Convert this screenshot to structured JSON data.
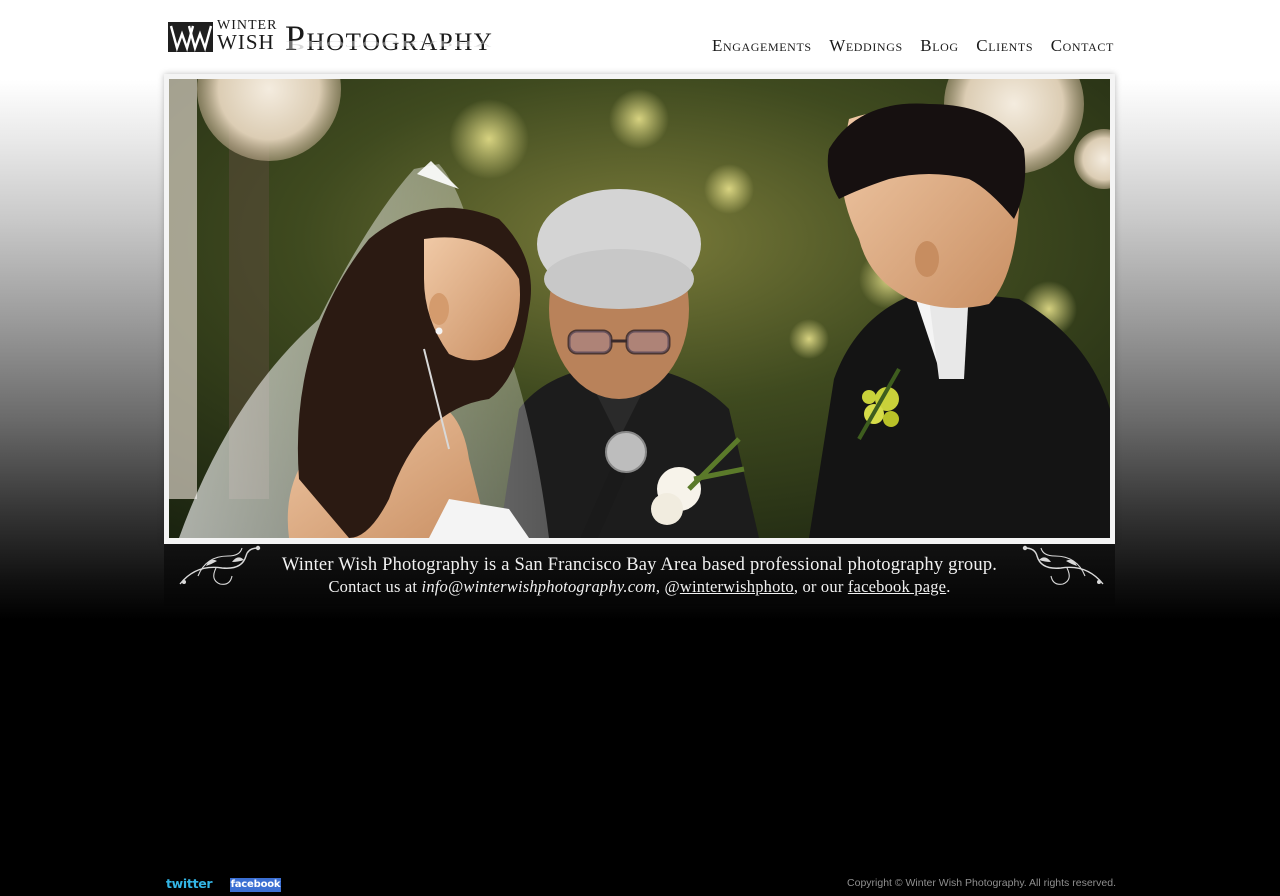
{
  "header": {
    "logo": {
      "mark": "WW",
      "winter": "WINTER",
      "wish": "WISH",
      "photography": "Photography"
    },
    "nav": [
      {
        "label": "Engagements"
      },
      {
        "label": "Weddings"
      },
      {
        "label": "Blog"
      },
      {
        "label": "Clients"
      },
      {
        "label": "Contact"
      }
    ]
  },
  "hero": {
    "caption_line1": "Winter Wish Photography is a San Francisco Bay Area based professional photography group.",
    "contact_prefix": "Contact us at ",
    "email": "info@winterwishphotography.com",
    "separator1": ", @",
    "twitter_handle": "winterwishphoto",
    "separator2": ", or our ",
    "facebook_text": "facebook page",
    "suffix": "."
  },
  "footer": {
    "twitter_label": "twitter",
    "facebook_label": "facebook",
    "copyright": "Copyright © Winter Wish Photography. All rights reserved."
  },
  "colors": {
    "twitter_blue": "#33b5e5",
    "facebook_blue": "#3b6fd3",
    "nav_text": "#1a1a1a",
    "caption_text": "#f1f1f1"
  }
}
